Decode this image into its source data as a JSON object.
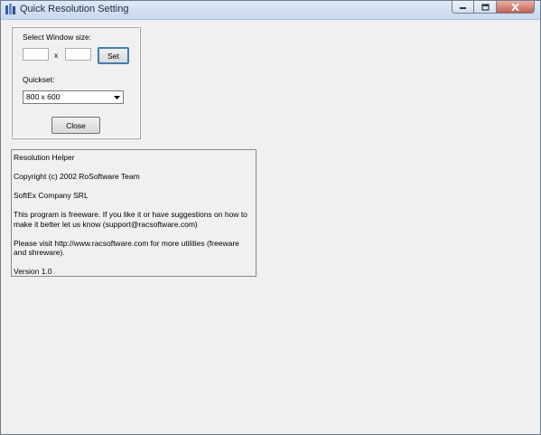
{
  "window": {
    "title": "Quick Resolution Setting"
  },
  "group": {
    "size_label": "Select Window size:",
    "width_value": "",
    "height_value": "",
    "x_label": "x",
    "set_label": "Set",
    "quickset_label": "Quickset:",
    "quickset_value": "800 x  600",
    "close_label": "Close"
  },
  "about": {
    "lines": [
      "Resolution Helper",
      "Copyright (c) 2002 RoSoftware Team",
      "SoftEx Company SRL",
      "This program is freeware. If you like it or have suggestions on how to make it better let us know (support@racsoftware.com)",
      "Please visit http://www.racsoftware.com for more utilities (freeware and shreware).",
      "Version 1.0"
    ]
  },
  "colors": {
    "titlebar": "#c8d8ec",
    "client": "#f0f0f0",
    "close_button": "#c45e4b"
  }
}
